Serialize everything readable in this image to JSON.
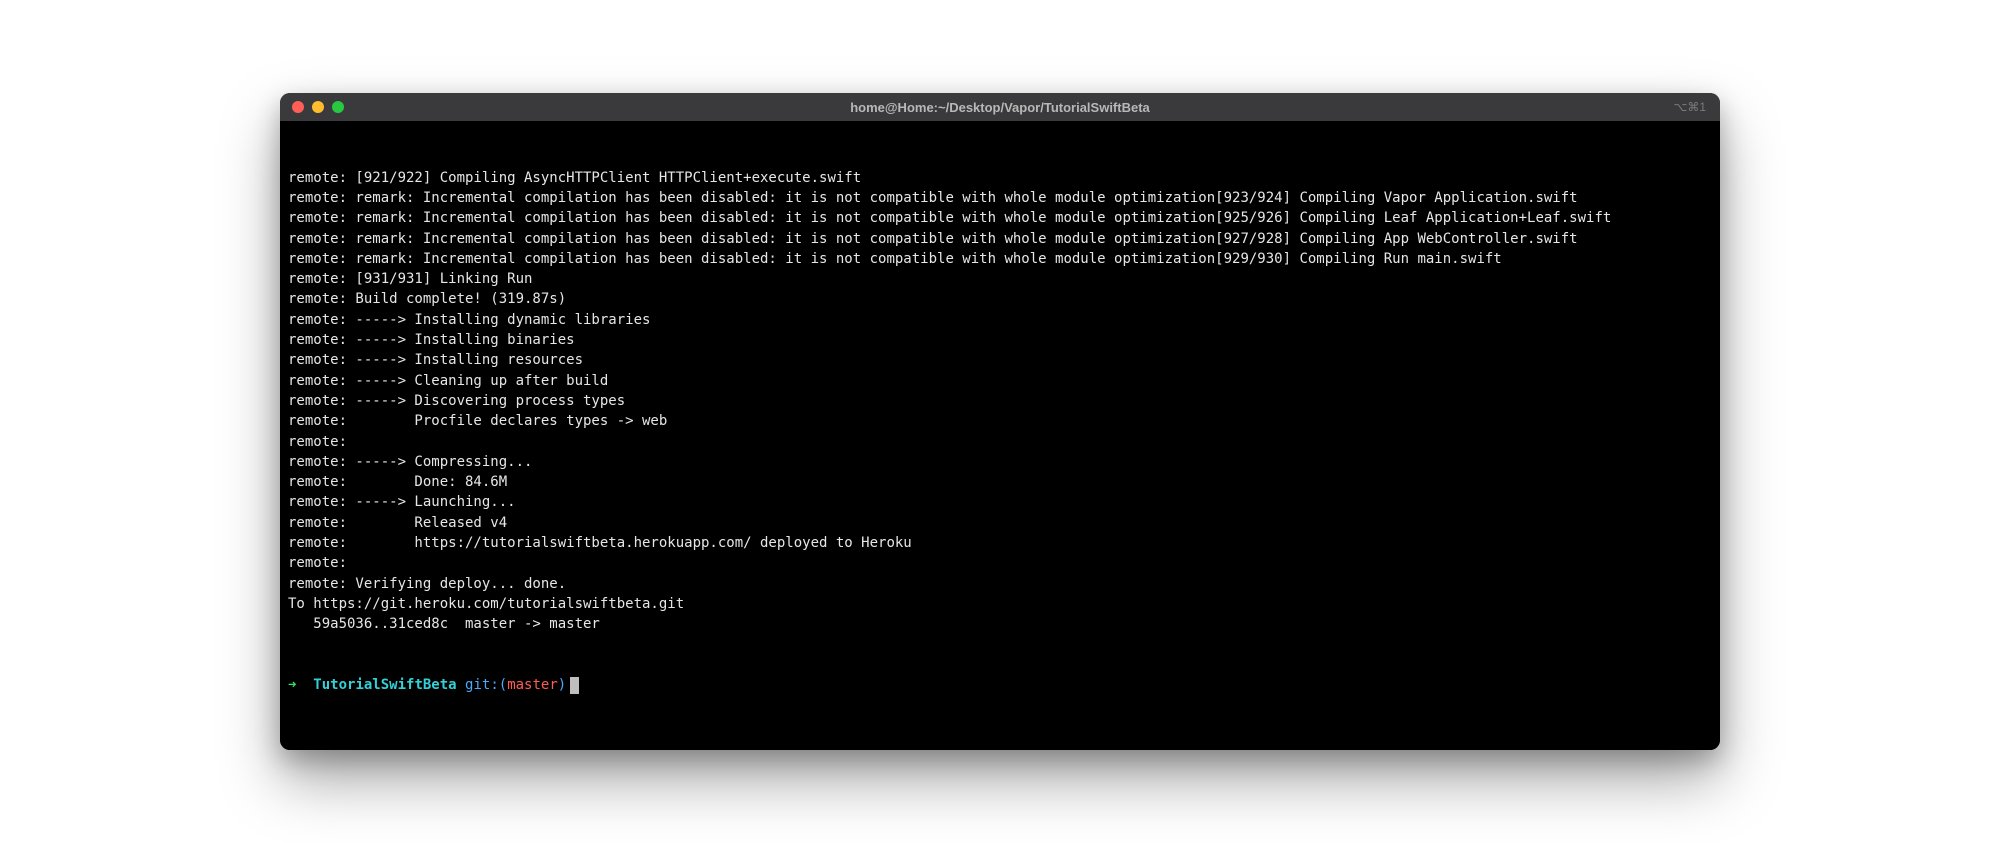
{
  "titlebar": {
    "title": "home@Home:~/Desktop/Vapor/TutorialSwiftBeta",
    "right_indicator": "⌥⌘1"
  },
  "terminal": {
    "lines": [
      "remote: [921/922] Compiling AsyncHTTPClient HTTPClient+execute.swift",
      "remote: remark: Incremental compilation has been disabled: it is not compatible with whole module optimization[923/924] Compiling Vapor Application.swift",
      "remote: remark: Incremental compilation has been disabled: it is not compatible with whole module optimization[925/926] Compiling Leaf Application+Leaf.swift",
      "remote: remark: Incremental compilation has been disabled: it is not compatible with whole module optimization[927/928] Compiling App WebController.swift",
      "remote: remark: Incremental compilation has been disabled: it is not compatible with whole module optimization[929/930] Compiling Run main.swift",
      "remote: [931/931] Linking Run",
      "remote: Build complete! (319.87s)",
      "remote: -----> Installing dynamic libraries",
      "remote: -----> Installing binaries",
      "remote: -----> Installing resources",
      "remote: -----> Cleaning up after build",
      "remote: -----> Discovering process types",
      "remote:        Procfile declares types -> web",
      "remote:",
      "remote: -----> Compressing...",
      "remote:        Done: 84.6M",
      "remote: -----> Launching...",
      "remote:        Released v4",
      "remote:        https://tutorialswiftbeta.herokuapp.com/ deployed to Heroku",
      "remote:",
      "remote: Verifying deploy... done.",
      "To https://git.heroku.com/tutorialswiftbeta.git",
      "   59a5036..31ced8c  master -> master"
    ]
  },
  "prompt": {
    "arrow": "➜",
    "dir": "TutorialSwiftBeta",
    "git_label": "git:(",
    "branch": "master",
    "git_close": ")"
  }
}
